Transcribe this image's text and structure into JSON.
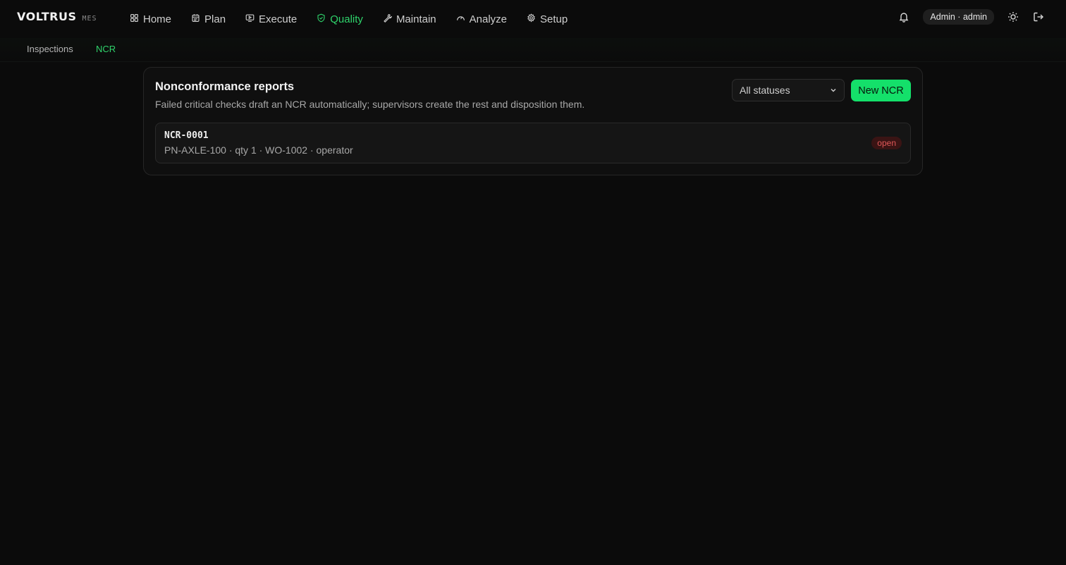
{
  "brand": {
    "name": "VOLTRUS",
    "sub": "MES"
  },
  "nav": [
    {
      "label": "Home",
      "icon": "grid-icon",
      "active": false
    },
    {
      "label": "Plan",
      "icon": "calendar-icon",
      "active": false
    },
    {
      "label": "Execute",
      "icon": "play-screen-icon",
      "active": false
    },
    {
      "label": "Quality",
      "icon": "shield-check-icon",
      "active": true
    },
    {
      "label": "Maintain",
      "icon": "wrench-icon",
      "active": false
    },
    {
      "label": "Analyze",
      "icon": "gauge-icon",
      "active": false
    },
    {
      "label": "Setup",
      "icon": "gear-icon",
      "active": false
    }
  ],
  "user": {
    "label": "Admin · admin"
  },
  "subnav": [
    {
      "label": "Inspections",
      "active": false
    },
    {
      "label": "NCR",
      "active": true
    }
  ],
  "card": {
    "title": "Nonconformance reports",
    "description": "Failed critical checks draft an NCR automatically; supervisors create the rest and disposition them.",
    "filter_value": "All statuses",
    "new_button": "New NCR"
  },
  "ncrs": [
    {
      "id": "NCR-0001",
      "meta": "PN-AXLE-100 · qty 1 · WO-1002 · operator",
      "status": "open"
    }
  ],
  "colors": {
    "accent": "#2fd36b",
    "button": "#14e06a",
    "status_open": "#e05858",
    "background": "#0b0b0b"
  }
}
